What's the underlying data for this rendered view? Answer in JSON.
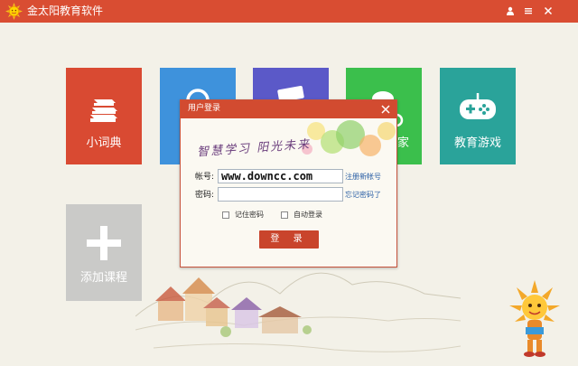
{
  "titlebar": {
    "title": "金太阳教育软件",
    "icons": [
      "sun-logo-icon",
      "user-icon",
      "menu-icon",
      "close-icon"
    ]
  },
  "tiles": [
    {
      "label": "小词典",
      "icon": "books-icon",
      "color": "#d94a32"
    },
    {
      "label": "",
      "icon": "globe-icon",
      "color": "#3e92dc"
    },
    {
      "label": "",
      "icon": "card-icon",
      "color": "#5b59c8"
    },
    {
      "label": "家",
      "icon": "home-icon",
      "color": "#3bbf4c"
    },
    {
      "label": "教育游戏",
      "icon": "gamepad-icon",
      "color": "#2aa39a"
    },
    {
      "label": "添加课程",
      "icon": "plus-icon",
      "color": "#cacac8"
    }
  ],
  "login_dialog": {
    "title": "用户登录",
    "slogan": "智慧学习 阳光未来",
    "account_label": "帐号:",
    "account_value": "www.downcc.com",
    "password_label": "密码:",
    "password_value": "",
    "register_link": "注册新帐号",
    "forgot_link": "忘记密码了",
    "remember_label": "记住密码",
    "auto_login_label": "自动登录",
    "login_button": "登 录"
  },
  "colors": {
    "accent": "#d94d32",
    "background": "#f3f1e8"
  }
}
